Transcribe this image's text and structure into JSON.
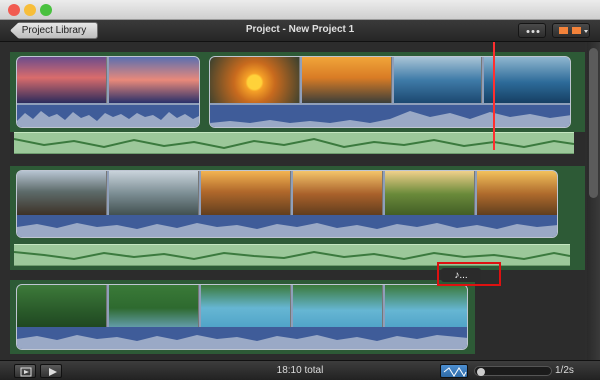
{
  "window": {
    "title": "Project - New Project 1",
    "back_button_label": "Project Library"
  },
  "footer": {
    "total": "18:10 total",
    "zoom_label": "1/2s"
  },
  "music": {
    "label": "♪..."
  },
  "colors": {
    "playhead": "#ff2f2f",
    "audio_track": "#9cc89a",
    "clip_bg": "#3f5c99"
  }
}
